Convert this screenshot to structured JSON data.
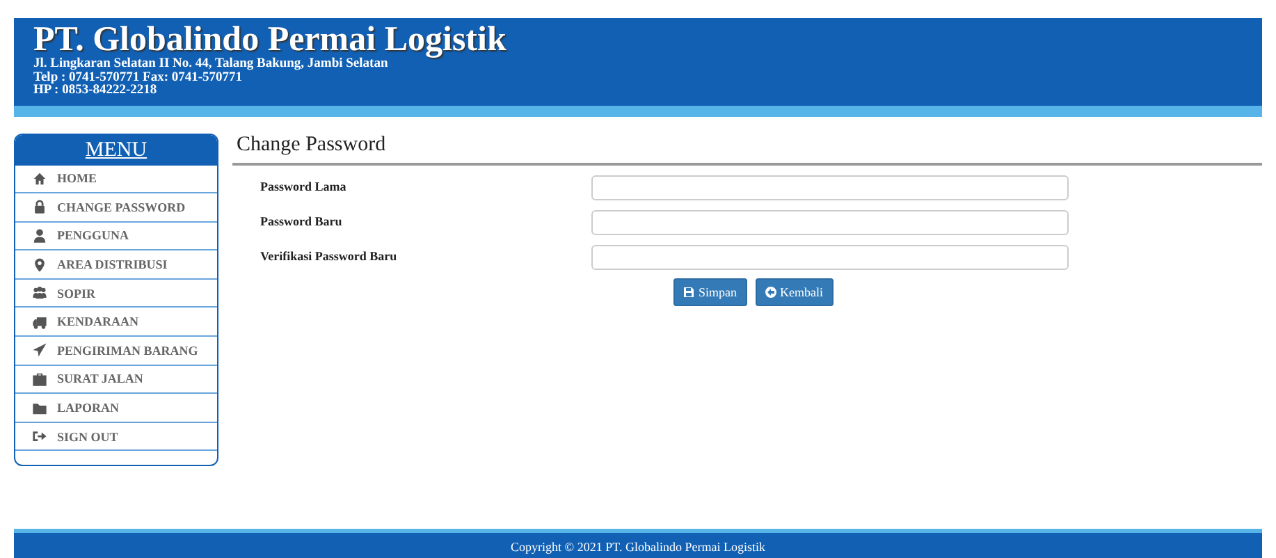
{
  "header": {
    "company": "PT. Globalindo Permai Logistik",
    "address": "Jl. Lingkaran Selatan II No. 44, Talang Bakung, Jambi Selatan",
    "phone": "Telp : 0741-570771 Fax: 0741-570771",
    "mobile": "HP : 0853-84222-2218"
  },
  "sidebar": {
    "title": "MENU",
    "items": [
      {
        "label": "HOME"
      },
      {
        "label": "CHANGE PASSWORD"
      },
      {
        "label": "PENGGUNA"
      },
      {
        "label": "AREA DISTRIBUSI"
      },
      {
        "label": "SOPIR"
      },
      {
        "label": "KENDARAAN"
      },
      {
        "label": "PENGIRIMAN BARANG"
      },
      {
        "label": "SURAT JALAN"
      },
      {
        "label": "LAPORAN"
      },
      {
        "label": "SIGN OUT"
      }
    ]
  },
  "form": {
    "title": "Change Password",
    "fields": [
      {
        "label": "Password Lama"
      },
      {
        "label": "Password Baru"
      },
      {
        "label": "Verifikasi Password Baru"
      }
    ],
    "buttons": [
      {
        "label": "Simpan",
        "kind": "save"
      },
      {
        "label": "Kembali",
        "kind": "back"
      }
    ]
  },
  "footer": {
    "text": "Copyright © 2021 PT. Globalindo Permai Logistik"
  }
}
